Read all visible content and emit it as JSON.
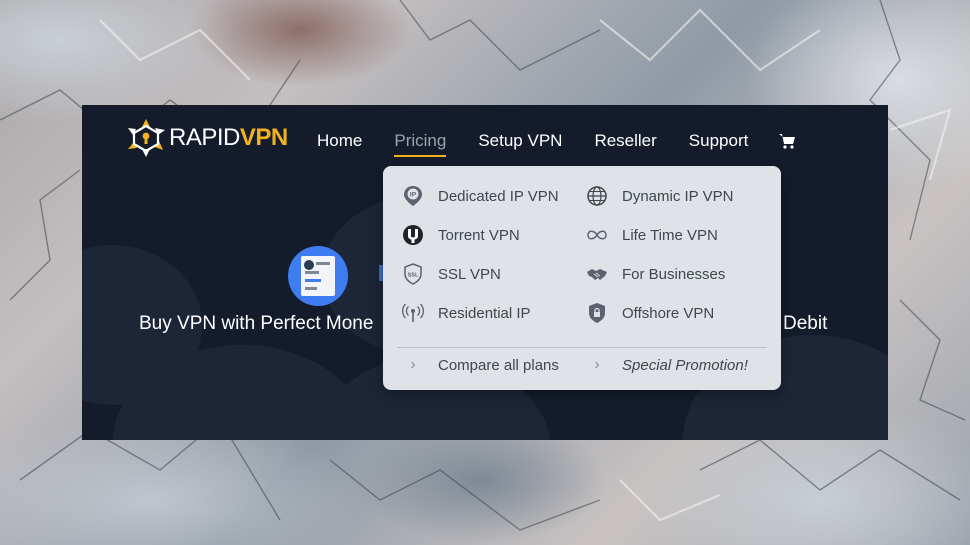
{
  "brand": {
    "name_light": "RAPID",
    "name_bold": "VPN"
  },
  "nav": {
    "items": [
      {
        "label": "Home"
      },
      {
        "label": "Pricing",
        "active": true
      },
      {
        "label": "Setup VPN"
      },
      {
        "label": "Reseller"
      },
      {
        "label": "Support"
      }
    ],
    "cart_icon": "cart-icon"
  },
  "hero": {
    "headline_left": "Buy VPN with Perfect Mone",
    "headline_right": "Debit"
  },
  "pricing_menu": {
    "left": [
      {
        "label": "Dedicated IP VPN",
        "icon": "ip-pin-icon"
      },
      {
        "label": "Torrent VPN",
        "icon": "torrent-icon"
      },
      {
        "label": "SSL VPN",
        "icon": "ssl-shield-icon"
      },
      {
        "label": "Residential IP",
        "icon": "antenna-icon"
      }
    ],
    "right": [
      {
        "label": "Dynamic IP VPN",
        "icon": "globe-icon"
      },
      {
        "label": "Life Time VPN",
        "icon": "infinity-icon"
      },
      {
        "label": "For Businesses",
        "icon": "handshake-icon"
      },
      {
        "label": "Offshore VPN",
        "icon": "lock-shield-icon"
      }
    ],
    "footer": {
      "compare": "Compare all plans",
      "promo": "Special Promotion!"
    }
  },
  "colors": {
    "accent": "#f2b21c",
    "panel": "#141c2c",
    "dropdown": "#dfe3e8"
  }
}
